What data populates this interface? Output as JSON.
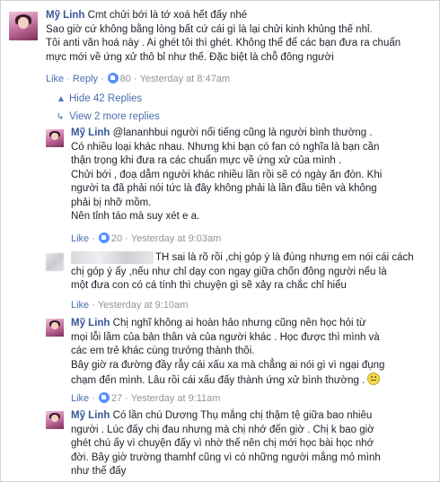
{
  "comments": [
    {
      "author": "Mỹ Linh",
      "first_line": "Cmt chửi bới là tớ xoá hết đấy nhé",
      "lines": [
        "Sao giờ cứ không bằng lòng bất cứ cái gì là lại chửi kinh khủng thế nhỉ.",
        "Tôi anti văn hoá này . Ai ghét tôi thì ghét. Không thể để các bạn đưa ra chuẩn",
        "mực mới về ứng xử thô bỉ như thế. Đặc biệt là chỗ đông người"
      ],
      "like": "Like",
      "reply": "Reply",
      "likes": "80",
      "time": "Yesterday at 8:47am"
    },
    {
      "author": "Mỹ Linh",
      "first_line": "@lananhbui người nổi tiếng cũng là người bình thường .",
      "lines": [
        "Có nhiều loại khác nhau. Nhưng khi bạn có fan có nghĩa là bạn cần",
        "thận trọng khi đưa ra các chuẩn mực về ứng xử của mình .",
        "Chửi bới , đoạ dẫm người khác nhiều lần rồi sẽ có ngày ăn đòn. Khi",
        "người ta đã phải nói tức là đây không phải là lần đầu tiên và không",
        "phải bị nhỡ mồm.",
        "Nên tỉnh táo mà suy xét e a."
      ],
      "like": "Like",
      "likes": "20",
      "time": "Yesterday at 9:03am"
    },
    {
      "first_line": "TH sai là rõ rồi ,chị góp ý là đúng nhưng em nói cái cách",
      "lines": [
        "chị góp ý ấy ,nếu như chỉ dạy con ngay giữa chốn đông người nếu là",
        "một đưa con có cá tính thì chuyện gì sẽ xảy ra chắc chỉ hiểu"
      ],
      "like": "Like",
      "time": "Yesterday at 9:10am"
    },
    {
      "author": "Mỹ Linh",
      "first_line": "Chị nghĩ không ai hoàn hảo nhưng cũng nên học hỏi từ",
      "lines": [
        "mọi lỗi lầm của bản thân và của người khác . Học được thì mình và",
        "các em trẻ khác cùng trưởng thành thôi.",
        "Bây giờ ra đường đầy rẫy cái xấu xa mà chẳng ai nói gì vì ngại đụng",
        "chạm đến mình. Lâu rồi cái xấu đấy thành ứng xử bình thường ."
      ],
      "like": "Like",
      "likes": "27",
      "time": "Yesterday at 9:11am"
    },
    {
      "author": "Mỹ Linh",
      "first_line": "Có lần chú Dương Thụ mắng chị thậm tệ giữa bao nhiêu",
      "lines": [
        "người . Lúc đấy chị đau nhưng mà chị nhớ đến giờ . Chị k bao giờ",
        "ghét chú ấy vì chuyện đấy vì nhờ thế nên chị mới học bài học nhớ",
        "đời. Bây giờ trường thamhf cũng vì có những người mắng mỏ mình",
        "như thế đấy"
      ]
    }
  ],
  "hide_replies": "Hide 42 Replies",
  "more_replies": "View 2 more replies",
  "separator": "·",
  "icons": {
    "like": "thumbs-up-icon",
    "hide": "collapse-arrow-icon",
    "more": "reply-arrow-icon",
    "emoji": "smiley-face-icon"
  },
  "colors": {
    "name": "#365899",
    "link": "#4b6eaf",
    "meta": "#90949c",
    "like_badge": "#5890ff"
  }
}
